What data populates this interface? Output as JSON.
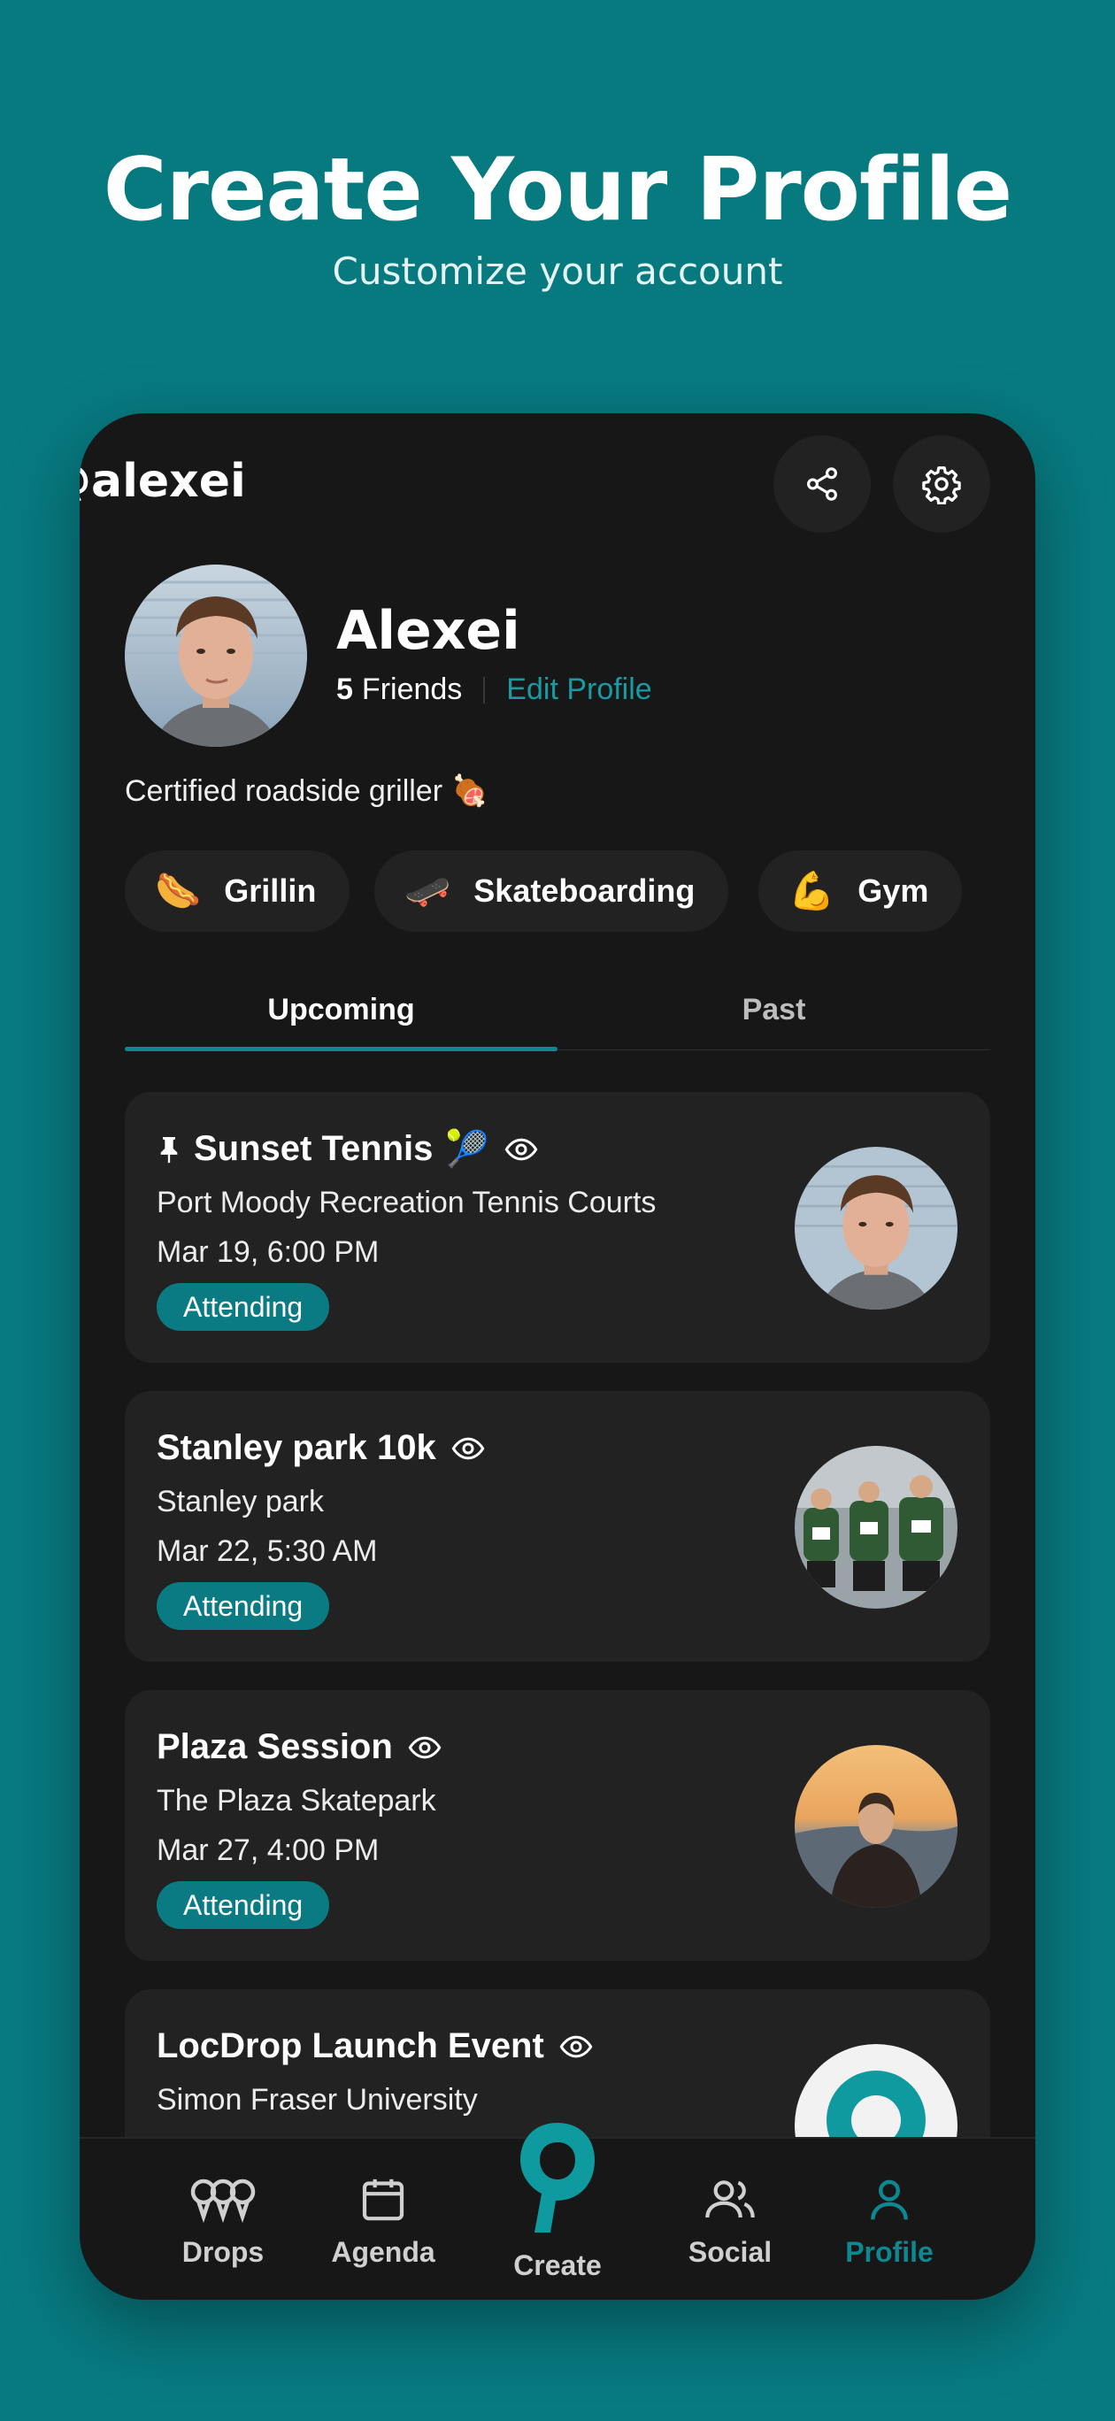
{
  "hero": {
    "title": "Create Your Profile",
    "subtitle": "Customize your account"
  },
  "profile": {
    "handle": "@alexei",
    "name": "Alexei",
    "friends_count": "5",
    "friends_label": "Friends",
    "edit_label": "Edit Profile",
    "bio": "Certified roadside griller 🍖"
  },
  "interests": [
    {
      "emoji": "🌭",
      "label": "Grillin"
    },
    {
      "emoji": "🛹",
      "label": "Skateboarding"
    },
    {
      "emoji": "💪",
      "label": "Gym"
    }
  ],
  "tabs": {
    "upcoming": "Upcoming",
    "past": "Past",
    "active": "upcoming"
  },
  "events": [
    {
      "title": "Sunset Tennis",
      "emoji": "🎾",
      "pinned": true,
      "location": "Port Moody Recreation Tennis Courts",
      "time": "Mar 19, 6:00 PM",
      "status": "Attending"
    },
    {
      "title": "Stanley park 10k",
      "emoji": "",
      "pinned": false,
      "location": "Stanley park",
      "time": "Mar 22, 5:30 AM",
      "status": "Attending"
    },
    {
      "title": "Plaza Session",
      "emoji": "",
      "pinned": false,
      "location": "The Plaza Skatepark",
      "time": "Mar 27, 4:00 PM",
      "status": "Attending"
    },
    {
      "title": "LocDrop Launch Event",
      "emoji": "",
      "pinned": false,
      "location": "Simon Fraser University",
      "time": "",
      "status": ""
    }
  ],
  "nav": {
    "drops": "Drops",
    "agenda": "Agenda",
    "create": "Create",
    "social": "Social",
    "profile": "Profile",
    "active": "profile"
  },
  "colors": {
    "background": "#077a80",
    "panel": "#171717",
    "card": "#222222",
    "accent": "#0d8890",
    "badge": "#0a7b82"
  }
}
